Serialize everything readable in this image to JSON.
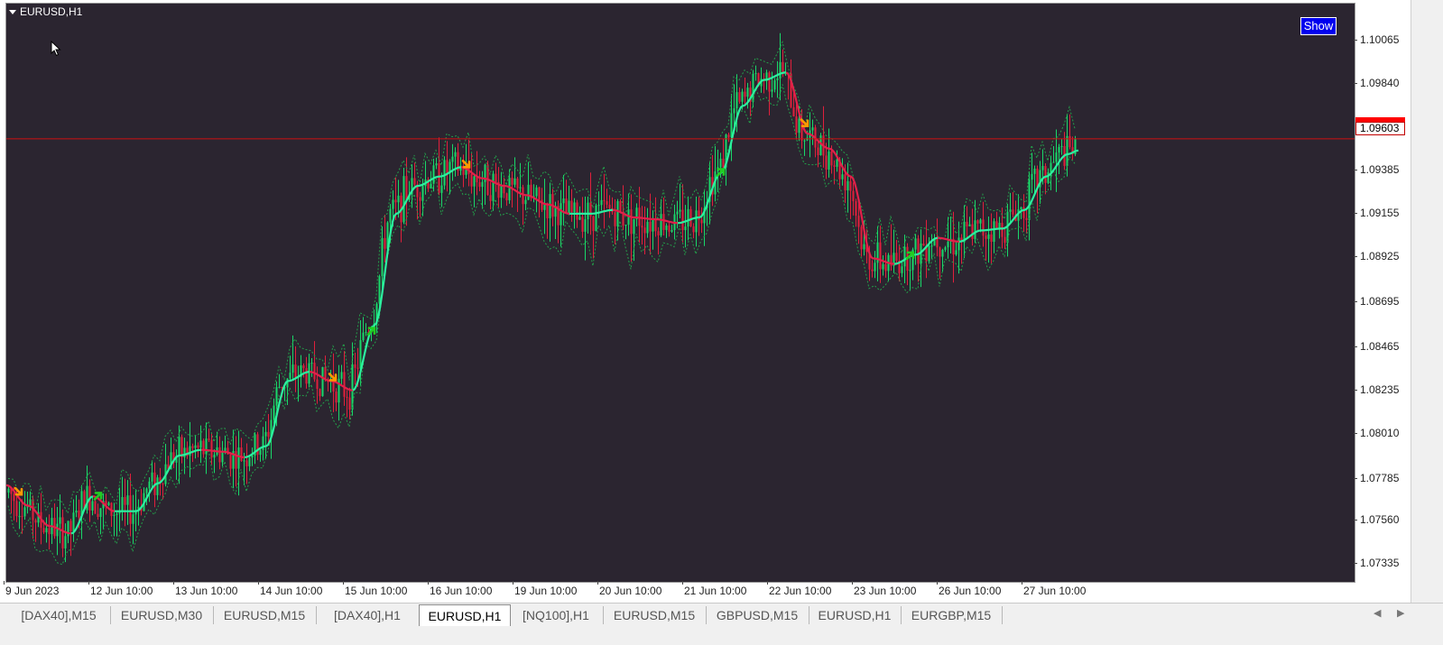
{
  "chart": {
    "title": "EURUSD,H1",
    "show_button": "Show",
    "current_price": "1.09603",
    "colors": {
      "background": "#2b2530",
      "bull": "#19d86a",
      "bear": "#e0203c",
      "ma_up": "#2cf0a0",
      "ma_down": "#e3204a",
      "price_line": "#d01010",
      "arrow_down": "#ff9900",
      "arrow_up": "#22cc22"
    }
  },
  "price_axis": [
    "1.10065",
    "1.09840",
    "1.09385",
    "1.09155",
    "1.08925",
    "1.08695",
    "1.08465",
    "1.08235",
    "1.08010",
    "1.07785",
    "1.07560",
    "1.07335"
  ],
  "time_axis": [
    "9 Jun 2023",
    "12 Jun 10:00",
    "13 Jun 10:00",
    "14 Jun 10:00",
    "15 Jun 10:00",
    "16 Jun 10:00",
    "19 Jun 10:00",
    "20 Jun 10:00",
    "21 Jun 10:00",
    "22 Jun 10:00",
    "23 Jun 10:00",
    "26 Jun 10:00",
    "27 Jun 10:00"
  ],
  "tabs": [
    {
      "label": "[DAX40],M15",
      "active": false
    },
    {
      "label": "EURUSD,M30",
      "active": false
    },
    {
      "label": "EURUSD,M15",
      "active": false
    },
    {
      "label": "[DAX40],H1",
      "active": false
    },
    {
      "label": "EURUSD,H1",
      "active": true
    },
    {
      "label": "[NQ100],H1",
      "active": false
    },
    {
      "label": "EURUSD,M15",
      "active": false
    },
    {
      "label": "GBPUSD,M15",
      "active": false
    },
    {
      "label": "EURUSD,H1",
      "active": false
    },
    {
      "label": "EURGBP,M15",
      "active": false
    }
  ],
  "chart_data": {
    "type": "candlestick",
    "symbol": "EURUSD",
    "timeframe": "H1",
    "ylim": [
      1.0722,
      1.1033
    ],
    "current_price": 1.09603,
    "ma_path": [
      [
        0,
        1.0774
      ],
      [
        24,
        1.0763
      ],
      [
        48,
        1.0752
      ],
      [
        72,
        1.0748
      ],
      [
        96,
        1.0768
      ],
      [
        120,
        1.076
      ],
      [
        144,
        1.076
      ],
      [
        168,
        1.0775
      ],
      [
        192,
        1.079
      ],
      [
        216,
        1.0793
      ],
      [
        240,
        1.0792
      ],
      [
        264,
        1.0789
      ],
      [
        288,
        1.0795
      ],
      [
        312,
        1.083
      ],
      [
        336,
        1.0835
      ],
      [
        360,
        1.083
      ],
      [
        384,
        1.0825
      ],
      [
        408,
        1.086
      ],
      [
        432,
        1.092
      ],
      [
        456,
        1.0935
      ],
      [
        480,
        1.094
      ],
      [
        504,
        1.0945
      ],
      [
        528,
        1.0939
      ],
      [
        552,
        1.0935
      ],
      [
        576,
        1.093
      ],
      [
        600,
        1.0925
      ],
      [
        624,
        1.092
      ],
      [
        648,
        1.092
      ],
      [
        672,
        1.0922
      ],
      [
        696,
        1.0918
      ],
      [
        720,
        1.0917
      ],
      [
        744,
        1.0915
      ],
      [
        768,
        1.0918
      ],
      [
        792,
        1.0942
      ],
      [
        816,
        1.0978
      ],
      [
        840,
        1.0992
      ],
      [
        864,
        1.0996
      ],
      [
        888,
        1.0963
      ],
      [
        912,
        1.0955
      ],
      [
        936,
        1.094
      ],
      [
        960,
        1.0896
      ],
      [
        984,
        1.0893
      ],
      [
        1008,
        1.0898
      ],
      [
        1032,
        1.0907
      ],
      [
        1056,
        1.0905
      ],
      [
        1080,
        1.0911
      ],
      [
        1104,
        1.0912
      ],
      [
        1128,
        1.0922
      ],
      [
        1152,
        1.094
      ],
      [
        1176,
        1.0952
      ],
      [
        1188,
        1.0954
      ]
    ],
    "signals": [
      {
        "i": 12,
        "type": "sell"
      },
      {
        "i": 100,
        "type": "buy"
      },
      {
        "i": 360,
        "type": "sell"
      },
      {
        "i": 403,
        "type": "buy"
      },
      {
        "i": 508,
        "type": "sell"
      },
      {
        "i": 790,
        "type": "buy"
      },
      {
        "i": 883,
        "type": "sell"
      },
      {
        "i": 1000,
        "type": "buy"
      }
    ]
  }
}
